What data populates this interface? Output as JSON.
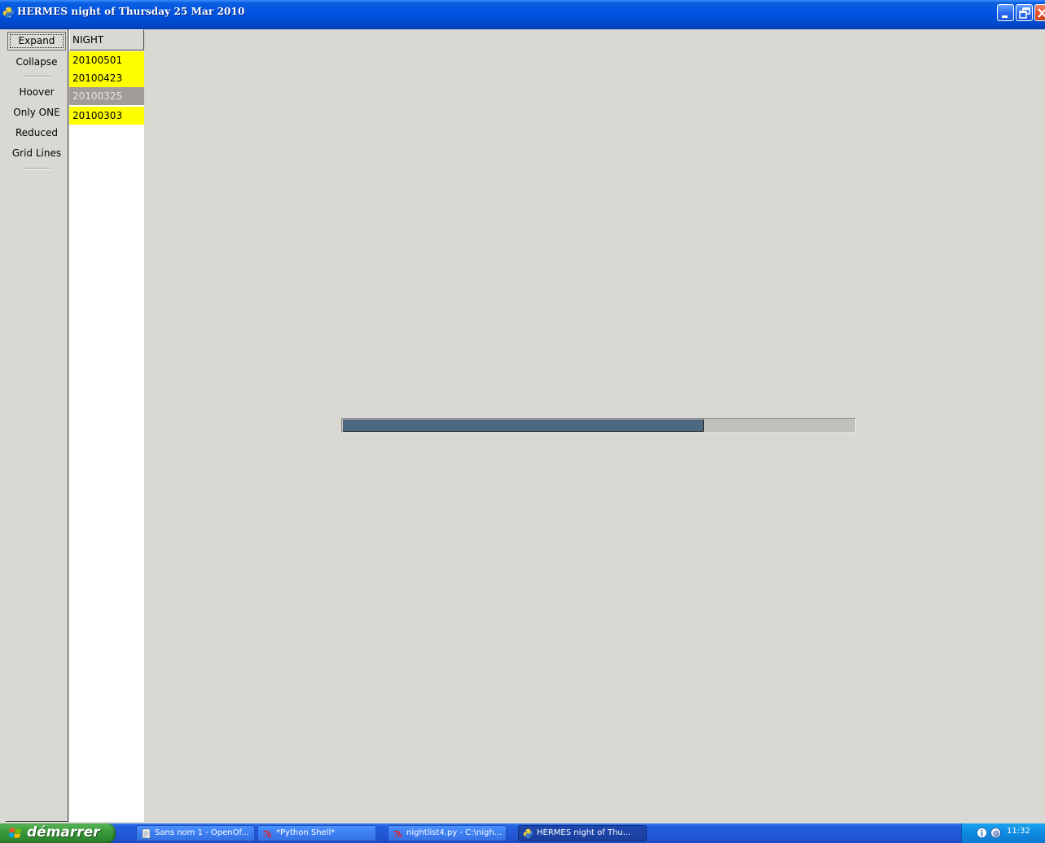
{
  "window": {
    "title": "HERMES night of Thursday 25 Mar 2010",
    "icon": "python-icon"
  },
  "toolbar": {
    "buttons": [
      {
        "label": "Expand",
        "focused": true
      },
      {
        "label": "Collapse"
      },
      {
        "label": "Hoover"
      },
      {
        "label": "Only ONE"
      },
      {
        "label": "Reduced"
      },
      {
        "label": "Grid Lines"
      }
    ]
  },
  "nightlist": {
    "header": "NIGHT",
    "rows": [
      {
        "label": "20100501",
        "color": "#ffff00",
        "selected": false
      },
      {
        "label": "20100423",
        "color": "#ffff00",
        "selected": false
      },
      {
        "label": "20100325",
        "color": "#a09c98",
        "selected": true
      },
      {
        "label": "20100303",
        "color": "#ffff00",
        "selected": false
      }
    ]
  },
  "progress": {
    "fraction": 0.705,
    "fill_color": "#4c6882",
    "track_color": "#c2c0bb"
  },
  "taskbar": {
    "start_label": "démarrer",
    "tasks": [
      {
        "label": "Sans nom 1 - OpenOf...",
        "icon": "openoffice-icon",
        "active": false
      },
      {
        "label": "*Python Shell*",
        "icon": "idle-icon",
        "active": false
      },
      {
        "label": "nightlist4.py - C:\\nigh...",
        "icon": "idle-icon",
        "active": false
      },
      {
        "label": "HERMES night of Thu...",
        "icon": "python-icon",
        "active": true
      }
    ],
    "clock": "11:32"
  },
  "colors": {
    "titlebar": "#0054e3",
    "highlight_row": "#ffff00",
    "selected_row": "#a09c98",
    "background": "#d9d8d3"
  }
}
